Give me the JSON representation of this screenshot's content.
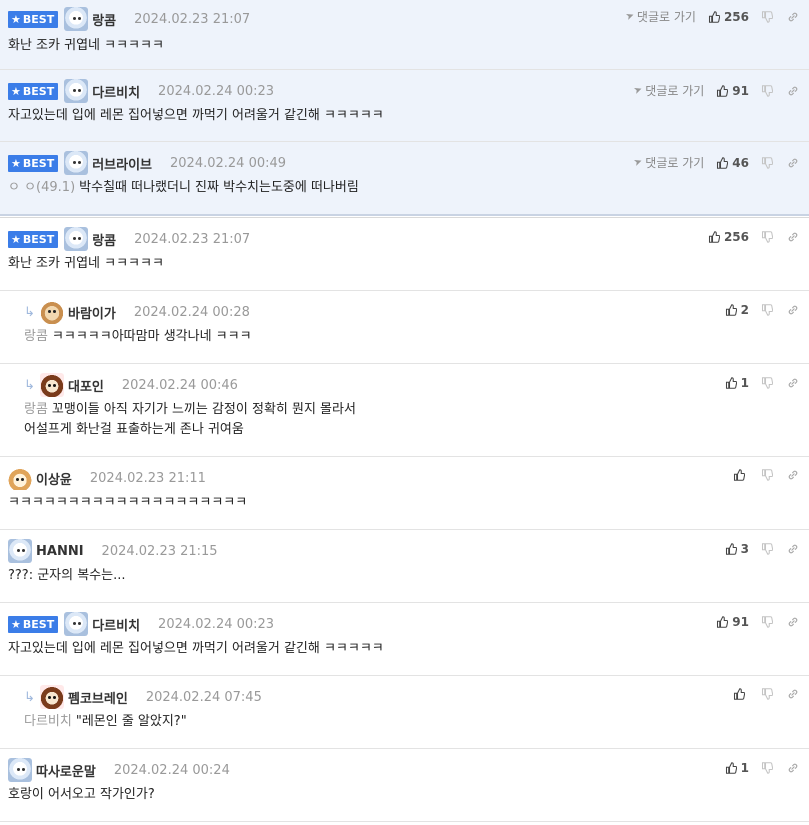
{
  "labels": {
    "best": "BEST",
    "reply_go": "댓글로 가기"
  },
  "best_comments": [
    {
      "nick": "랑콤",
      "date": "2024.02.23 21:07",
      "likes": "256",
      "text": "화난 조카 귀엽네 ㅋㅋㅋㅋㅋ"
    },
    {
      "nick": "다르비치",
      "date": "2024.02.24 00:23",
      "likes": "91",
      "text": "자고있는데 입에 레몬 집어넣으면 까먹기 어려울거 같긴해 ㅋㅋㅋㅋㅋ"
    },
    {
      "nick": "러브라이브",
      "date": "2024.02.24 00:49",
      "likes": "46",
      "level": "ㅇ ㅇ(49.1)",
      "text": "박수칠때 떠나랬더니 진짜 박수치는도중에 떠나버림"
    }
  ],
  "comments": [
    {
      "nick": "랑콤",
      "date": "2024.02.23 21:07",
      "likes": "256",
      "text": "화난 조카 귀엽네 ㅋㅋㅋㅋㅋ"
    },
    {
      "nick": "바람이가",
      "date": "2024.02.24 00:28",
      "likes": "2",
      "mention": "랑콤",
      "text": "ㅋㅋㅋㅋㅋ아따맘마 생각나네 ㅋㅋㅋ"
    },
    {
      "nick": "대포인",
      "date": "2024.02.24 00:46",
      "likes": "1",
      "mention": "랑콤",
      "text_line1": "꼬맹이들 아직 자기가 느끼는 감정이 정확히 뭔지 몰라서",
      "text_line2": "어설프게 화난걸 표출하는게 존나 귀여움"
    },
    {
      "nick": "이상윤",
      "date": "2024.02.23 21:11",
      "likes": "",
      "text": "ㅋㅋㅋㅋㅋㅋㅋㅋㅋㅋㅋㅋㅋㅋㅋㅋㅋㅋㅋㅋ"
    },
    {
      "nick": "HANNI",
      "date": "2024.02.23 21:15",
      "likes": "3",
      "text": "???: 군자의 복수는..."
    },
    {
      "nick": "다르비치",
      "date": "2024.02.24 00:23",
      "likes": "91",
      "text": "자고있는데 입에 레몬 집어넣으면 까먹기 어려울거 같긴해 ㅋㅋㅋㅋㅋ"
    },
    {
      "nick": "펨코브레인",
      "date": "2024.02.24 07:45",
      "likes": "",
      "mention": "다르비치",
      "text": "\"레몬인 줄 알았지?\""
    },
    {
      "nick": "따사로운말",
      "date": "2024.02.24 00:24",
      "likes": "1",
      "text": "호랑이 어서오고 작가인가?"
    }
  ]
}
